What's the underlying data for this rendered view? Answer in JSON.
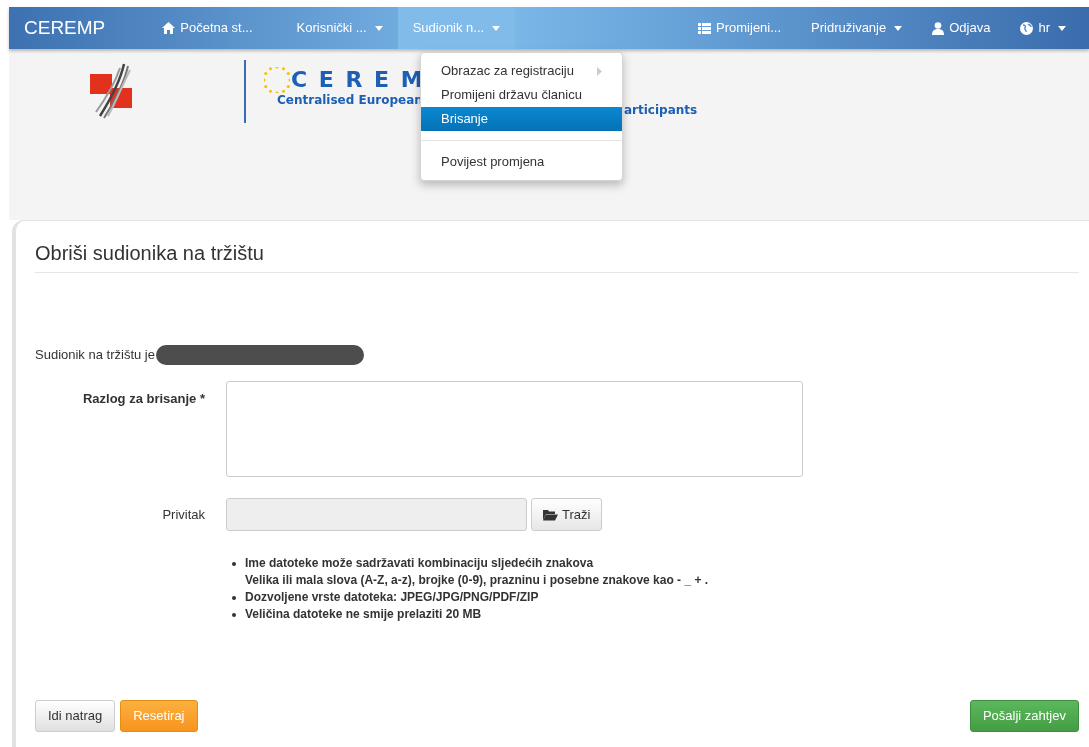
{
  "navbar": {
    "brand": "CEREMP",
    "left_items": [
      {
        "kind": "home",
        "label": "Početna st...",
        "caret": false,
        "selected": false
      },
      {
        "kind": "plain",
        "label": "Korisnički ...",
        "caret": true,
        "selected": false
      },
      {
        "kind": "plain",
        "label": "Sudionik n...",
        "caret": true,
        "selected": true
      }
    ],
    "right_items": [
      {
        "kind": "list",
        "label": "Promijeni...",
        "caret": false,
        "selected": false
      },
      {
        "kind": "plain",
        "label": "Pridruživanje",
        "caret": true,
        "selected": false
      },
      {
        "kind": "user",
        "label": "Odjava",
        "caret": false,
        "selected": false
      },
      {
        "kind": "globe",
        "label": "hr",
        "caret": true,
        "selected": false
      }
    ]
  },
  "dropdown": {
    "items": [
      {
        "kind": "item",
        "label": "Obrazac za registraciju",
        "submenu": true,
        "selected": false
      },
      {
        "kind": "item",
        "label": "Promijeni državu članicu",
        "submenu": false,
        "selected": false
      },
      {
        "kind": "item",
        "label": "Brisanje",
        "submenu": false,
        "selected": true
      },
      {
        "kind": "divider"
      },
      {
        "kind": "item",
        "label": "Povijest promjena",
        "submenu": false,
        "selected": false
      }
    ]
  },
  "header": {
    "logo_title": "C E R E M",
    "logo_subtitle": "Centralised European",
    "logo_subtitle_tail": "articipants"
  },
  "form": {
    "title": "Obriši sudionika na tržištu",
    "participant_label": "Sudionik na tržištu je",
    "participant_redacted": true,
    "reason_label": "Razlog za brisanje *",
    "attachment_label": "Privitak",
    "browse_button": "Traži",
    "hints": [
      {
        "lines": [
          "Ime datoteke može sadržavati kombinaciju sljedećih znakova",
          "Velika ili mala slova (A-Z, a-z), brojke (0-9), prazninu i posebne znakove kao - _ + ."
        ]
      },
      {
        "lines": [
          "Dozvoljene vrste datoteka: JPEG/JPG/PNG/PDF/ZIP"
        ]
      },
      {
        "lines": [
          "Veličina datoteke ne smije prelaziti 20 MB"
        ]
      }
    ]
  },
  "actions": [
    {
      "kind": "default",
      "label": "Idi natrag"
    },
    {
      "kind": "warning",
      "label": "Resetiraj"
    },
    {
      "kind": "success",
      "label": "Pošalji zahtjev"
    }
  ]
}
